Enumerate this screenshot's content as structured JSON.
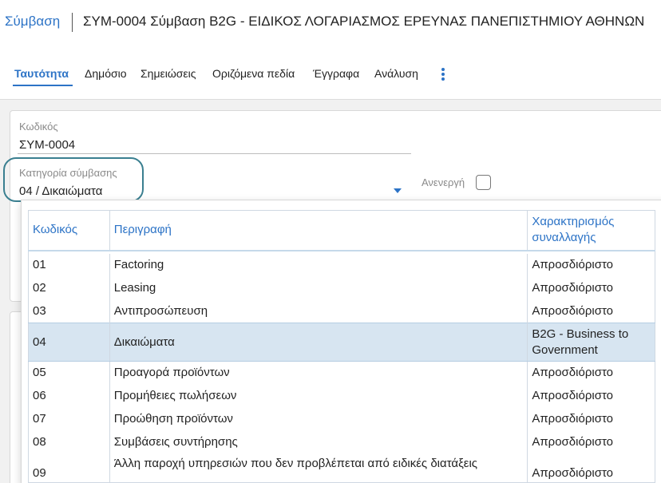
{
  "header": {
    "breadcrumb": "Σύμβαση",
    "title": "ΣΥΜ-0004 Σύμβαση B2G - ΕΙΔΙΚΟΣ ΛΟΓΑΡΙΑΣΜΟΣ ΕΡΕΥΝΑΣ ΠΑΝΕΠΙΣΤΗΜΙΟΥ ΑΘΗΝΩΝ"
  },
  "tabs": [
    {
      "label": "Ταυτότητα",
      "active": true
    },
    {
      "label": "Δημόσιο"
    },
    {
      "label": "Σημειώσεις"
    },
    {
      "label": "Οριζόμενα πεδία"
    },
    {
      "label": "Έγγραφα"
    },
    {
      "label": "Ανάλυση"
    }
  ],
  "form": {
    "code_label": "Κωδικός",
    "code_value": "ΣΥΜ-0004",
    "category_label": "Κατηγορία σύμβασης",
    "category_value": "04 / Δικαιώματα",
    "inactive_label": "Ανενεργή",
    "inactive_checked": false
  },
  "dropdown": {
    "columns": [
      "Κωδικός",
      "Περιγραφή",
      "Χαρακτηρισμός συναλλαγής"
    ],
    "selected_index": 3,
    "rows": [
      {
        "code": "01",
        "desc": "Factoring",
        "type": "Απροσδιόριστο"
      },
      {
        "code": "02",
        "desc": "Leasing",
        "type": "Απροσδιόριστο"
      },
      {
        "code": "03",
        "desc": "Αντιπροσώπευση",
        "type": "Απροσδιόριστο"
      },
      {
        "code": "04",
        "desc": "Δικαιώματα",
        "type": "B2G - Business to Government"
      },
      {
        "code": "05",
        "desc": "Προαγορά προϊόντων",
        "type": "Απροσδιόριστο"
      },
      {
        "code": "06",
        "desc": "Προμήθειες πωλήσεων",
        "type": "Απροσδιόριστο"
      },
      {
        "code": "07",
        "desc": "Προώθηση προϊόντων",
        "type": "Απροσδιόριστο"
      },
      {
        "code": "08",
        "desc": "Συμβάσεις συντήρησης",
        "type": "Απροσδιόριστο"
      },
      {
        "code": "09",
        "desc": "Άλλη παροχή υπηρεσιών που δεν προβλέπεται από ειδικές διατάξεις",
        "type": "Απροσδιόριστο"
      }
    ]
  },
  "colors": {
    "accent": "#2c73c6",
    "selected_row": "#d7e5f1",
    "focus_ring": "#3a7f90"
  },
  "icons": {
    "more": "vertical-ellipsis-icon",
    "caret": "caret-down-icon"
  }
}
